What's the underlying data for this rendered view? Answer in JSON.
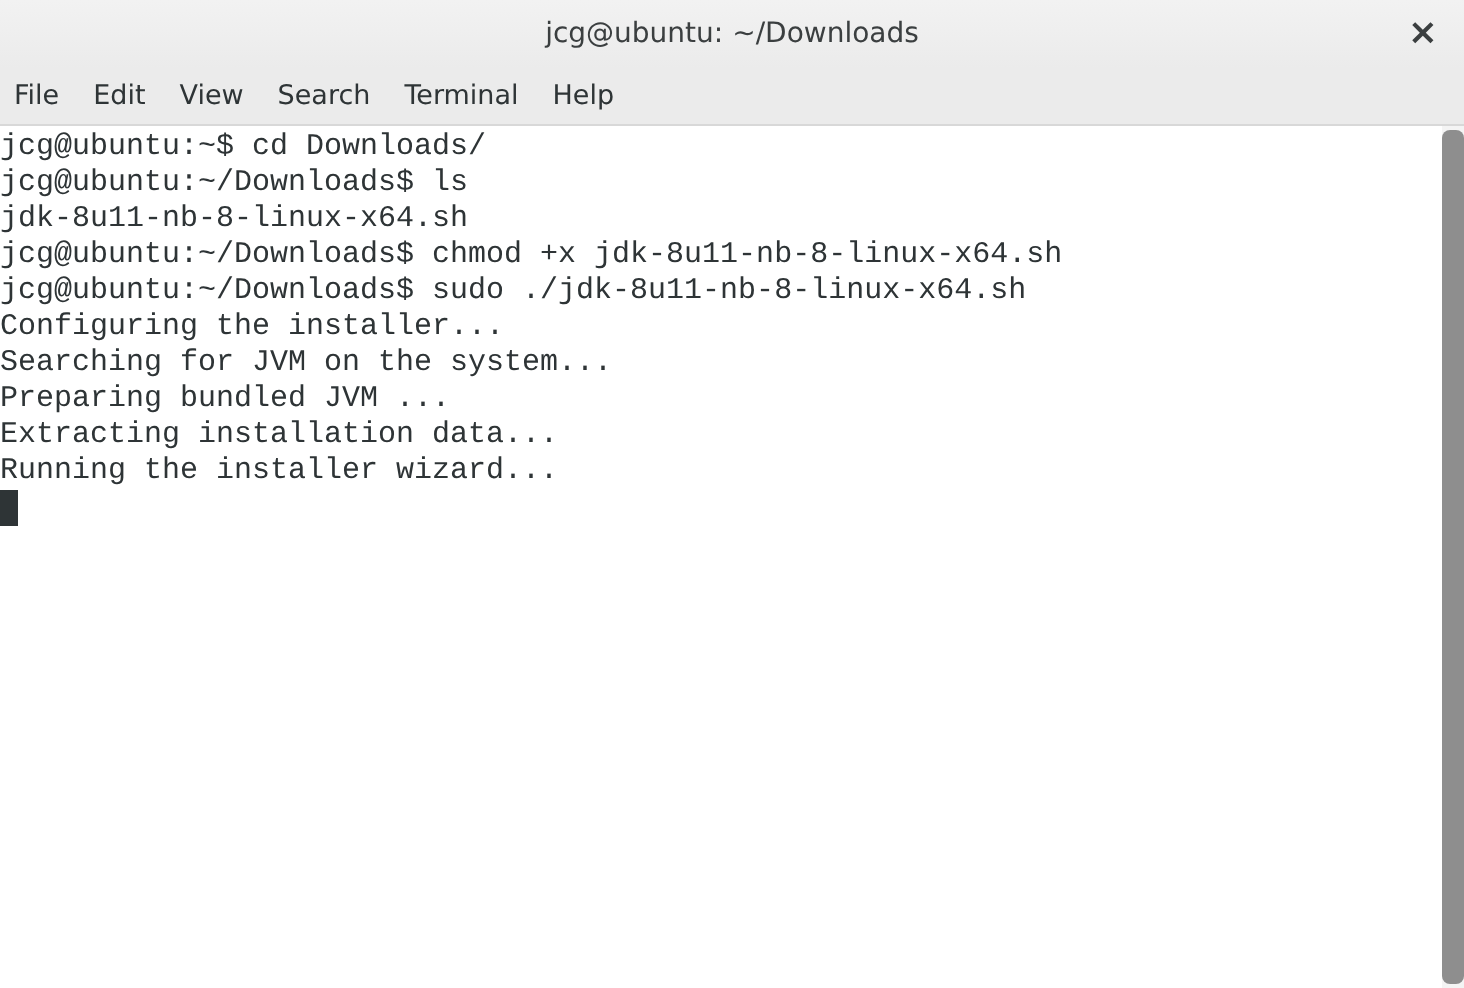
{
  "window": {
    "title": "jcg@ubuntu: ~/Downloads",
    "close": "×"
  },
  "menu": [
    "File",
    "Edit",
    "View",
    "Search",
    "Terminal",
    "Help"
  ],
  "terminal": {
    "lines": [
      "jcg@ubuntu:~$ cd Downloads/",
      "jcg@ubuntu:~/Downloads$ ls",
      "jdk-8u11-nb-8-linux-x64.sh",
      "jcg@ubuntu:~/Downloads$ chmod +x jdk-8u11-nb-8-linux-x64.sh",
      "jcg@ubuntu:~/Downloads$ sudo ./jdk-8u11-nb-8-linux-x64.sh",
      "Configuring the installer...",
      "Searching for JVM on the system...",
      "Preparing bundled JVM ...",
      "Extracting installation data...",
      "Running the installer wizard..."
    ],
    "cursor": true
  }
}
